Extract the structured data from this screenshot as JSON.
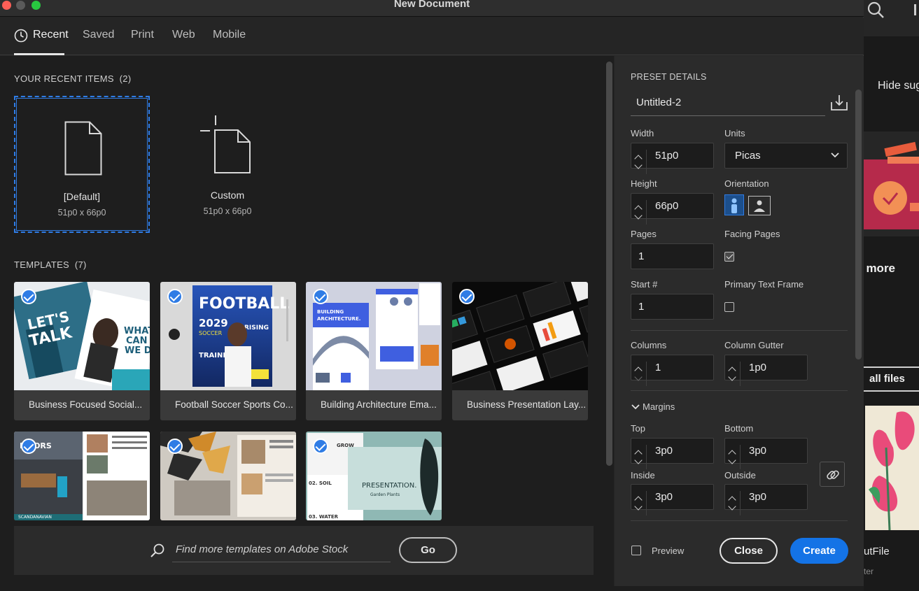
{
  "window": {
    "title": "New Document"
  },
  "tabs": [
    {
      "label": "Recent",
      "active": true
    },
    {
      "label": "Saved"
    },
    {
      "label": "Print"
    },
    {
      "label": "Web"
    },
    {
      "label": "Mobile"
    }
  ],
  "recent": {
    "heading": "YOUR RECENT ITEMS",
    "count": "(2)",
    "items": [
      {
        "name": "[Default]",
        "size": "51p0 x 66p0"
      },
      {
        "name": "Custom",
        "size": "51p0 x 66p0"
      }
    ]
  },
  "templates": {
    "heading": "TEMPLATES",
    "count": "(7)",
    "items": [
      {
        "caption": "Business Focused Social..."
      },
      {
        "caption": "Football Soccer Sports Co..."
      },
      {
        "caption": "Building Architecture Ema..."
      },
      {
        "caption": "Business Presentation Lay..."
      },
      {
        "caption": ""
      },
      {
        "caption": ""
      },
      {
        "caption": ""
      }
    ],
    "thumb_text": {
      "t1_lets": "LET'S",
      "t1_talk": "TALK",
      "t1_what": "WHAT",
      "t1_can": "CAN",
      "t1_wedo": "WE D",
      "t2_football": "FOOTBALL",
      "t2_year": "2029",
      "t2_soccer": "SOCCER",
      "t2_training": "TRAINING",
      "t2_rising": "RISING",
      "t3_building": "BUILDING",
      "t3_arch": "ARCHITECTURE.",
      "t5_interiors": "ERIORS",
      "t5_scand": "SCANDANAVIAN",
      "t7_grow": "GROW",
      "t7_soil": "02. SOIL",
      "t7_water": "03. WATER",
      "t7_presentation": "PRESENTATION.",
      "t7_garden": "Garden Plants"
    }
  },
  "stock": {
    "placeholder": "Find more templates on Adobe Stock",
    "go_label": "Go"
  },
  "preset": {
    "heading": "PRESET DETAILS",
    "name": "Untitled-2",
    "width_label": "Width",
    "width": "51p0",
    "units_label": "Units",
    "units": "Picas",
    "height_label": "Height",
    "height": "66p0",
    "orientation_label": "Orientation",
    "orientation": "portrait",
    "pages_label": "Pages",
    "pages": "1",
    "facing_label": "Facing Pages",
    "facing_pages": true,
    "start_label": "Start #",
    "start": "1",
    "ptf_label": "Primary Text Frame",
    "primary_text_frame": false,
    "columns_label": "Columns",
    "columns": "1",
    "gutter_label": "Column Gutter",
    "gutter": "1p0",
    "margins_label": "Margins",
    "top_label": "Top",
    "top": "3p0",
    "bottom_label": "Bottom",
    "bottom": "3p0",
    "inside_label": "Inside",
    "inside": "3p0",
    "outside_label": "Outside",
    "outside": "3p0"
  },
  "footer": {
    "preview_label": "Preview",
    "preview": false,
    "close_label": "Close",
    "create_label": "Create"
  },
  "background_app": {
    "hide_suggestions": "Hide sugg",
    "learn_more": "l more",
    "all_files": "all files",
    "file_name": "utFile",
    "file_sub": "ter"
  },
  "colors": {
    "accent": "#1473e6",
    "selection": "#2f7ce5",
    "panel": "#2b2b2b",
    "background": "#1e1e1e"
  }
}
